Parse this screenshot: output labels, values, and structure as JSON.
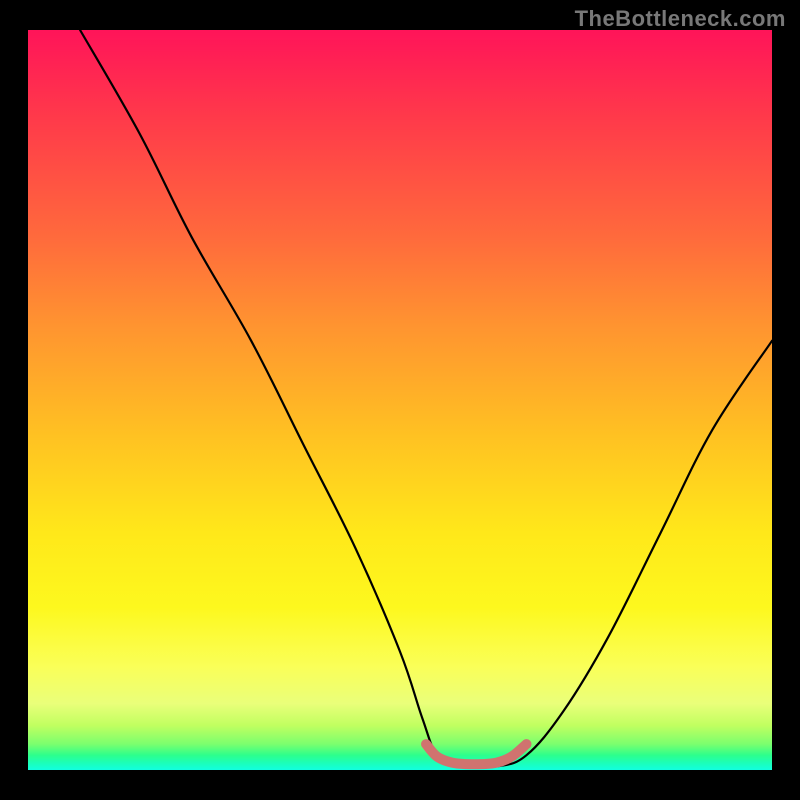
{
  "watermark": "TheBottleneck.com",
  "chart_data": {
    "type": "line",
    "title": "",
    "xlabel": "",
    "ylabel": "",
    "xlim": [
      0,
      100
    ],
    "ylim": [
      0,
      100
    ],
    "grid": false,
    "legend": false,
    "annotations": [
      {
        "text": "TheBottleneck.com",
        "position": "top-right"
      }
    ],
    "series": [
      {
        "name": "black-curve",
        "color": "#000000",
        "x": [
          7,
          15,
          22,
          30,
          37,
          44,
          50,
          53,
          55,
          58,
          63,
          67,
          72,
          78,
          85,
          92,
          100
        ],
        "y": [
          100,
          86,
          72,
          58,
          44,
          30,
          16,
          7,
          2,
          0.5,
          0.5,
          2,
          8,
          18,
          32,
          46,
          58
        ]
      },
      {
        "name": "red-segment",
        "color": "#d0736f",
        "x": [
          53.5,
          55,
          57,
          59,
          61,
          63,
          65,
          67
        ],
        "y": [
          3.5,
          1.8,
          1.0,
          0.8,
          0.8,
          1.0,
          1.8,
          3.5
        ]
      }
    ],
    "colors": {
      "gradient_top": "#ff1459",
      "gradient_mid1": "#ffc222",
      "gradient_mid2": "#fdf81e",
      "gradient_bottom": "#12ffe0",
      "background": "#000000",
      "watermark": "#787878"
    }
  }
}
